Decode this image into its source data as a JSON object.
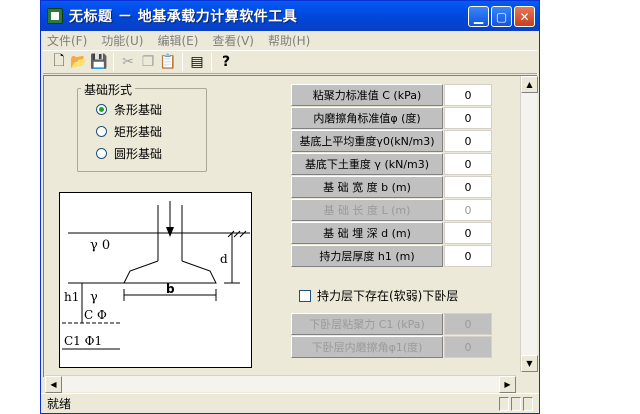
{
  "window": {
    "title": "无标题 － 地基承载力计算软件工具"
  },
  "menu": [
    "文件(F)",
    "功能(U)",
    "编辑(E)",
    "查看(V)",
    "帮助(H)"
  ],
  "toolbar": {
    "new": "🗋",
    "open": "📂",
    "save": "💾",
    "cut": "✂",
    "copy": "❐",
    "paste": "📋",
    "calc": "▤",
    "help": "?"
  },
  "foundation_type": {
    "title": "基础形式",
    "options": [
      {
        "label": "条形基础",
        "selected": true
      },
      {
        "label": "矩形基础",
        "selected": false
      },
      {
        "label": "圆形基础",
        "selected": false
      }
    ]
  },
  "diagram": {
    "gamma0": "γ 0",
    "d": "d",
    "h1": "h1",
    "gamma": "γ",
    "b": "b",
    "c_phi": "C  Φ",
    "c1_phi1": "C1   Φ1"
  },
  "params": [
    {
      "label": "粘聚力标准值 C  (kPa)",
      "value": "0",
      "enabled": true
    },
    {
      "label": "内磨擦角标准值φ (度)",
      "value": "0",
      "enabled": true
    },
    {
      "label": "基底上平均重度γ0(kN/m3)",
      "value": "0",
      "enabled": true
    },
    {
      "label": "基底下土重度 γ (kN/m3)",
      "value": "0",
      "enabled": true
    },
    {
      "label": "基 础 宽 度 b   (m)",
      "value": "0",
      "enabled": true
    },
    {
      "label": "基 础 长 度 L   (m)",
      "value": "0",
      "enabled": false
    },
    {
      "label": "基 础 埋 深 d   (m)",
      "value": "0",
      "enabled": true
    },
    {
      "label": "持力层厚度 h1   (m)",
      "value": "0",
      "enabled": true
    }
  ],
  "weak_layer": {
    "checkbox_label": "持力层下存在(软弱)下卧层",
    "checked": false,
    "params": [
      {
        "label": "下卧层粘聚力 C1 (kPa)",
        "value": "0"
      },
      {
        "label": "下卧层内磨擦角φ1(度)",
        "value": "0"
      }
    ]
  },
  "status": {
    "text": "就绪"
  }
}
